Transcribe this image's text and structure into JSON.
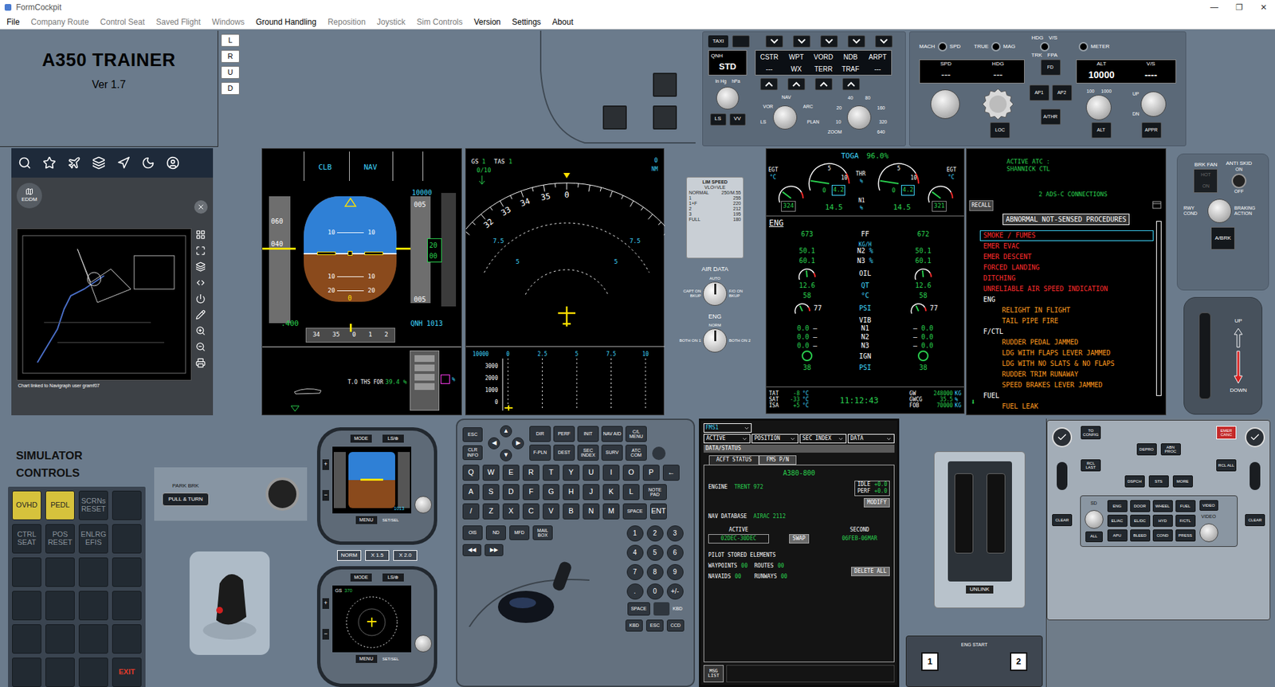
{
  "window": {
    "title": "FormCockpit",
    "controls": [
      "—",
      "❐",
      "✕"
    ]
  },
  "menu": [
    {
      "label": "File",
      "disabled": false
    },
    {
      "label": "Company Route",
      "disabled": true
    },
    {
      "label": "Control Seat",
      "disabled": true
    },
    {
      "label": "Saved Flight",
      "disabled": true
    },
    {
      "label": "Windows",
      "disabled": true
    },
    {
      "label": "Ground Handling",
      "disabled": false
    },
    {
      "label": "Reposition",
      "disabled": true
    },
    {
      "label": "Joystick",
      "disabled": true
    },
    {
      "label": "Sim Controls",
      "disabled": true
    },
    {
      "label": "Version",
      "disabled": false
    },
    {
      "label": "Settings",
      "disabled": false
    },
    {
      "label": "About",
      "disabled": false
    }
  ],
  "trainer": {
    "title": "A350 TRAINER",
    "version": "Ver 1.7",
    "views": [
      "L",
      "R",
      "U",
      "D"
    ]
  },
  "efis": {
    "taxi": "TAXI",
    "qnh_label": "QNH",
    "qnh": "STD",
    "baro_units": [
      "In Hg",
      "hPa"
    ],
    "buttons_top": [
      "CSTR",
      "WPT",
      "VORD",
      "NDB",
      "ARPT"
    ],
    "buttons_bottom": [
      "---",
      "WX",
      "TERR",
      "TRAF",
      "---"
    ],
    "ls": "LS",
    "vv": "VV",
    "mode_labels": [
      "VOR",
      "NAV",
      "ARC",
      "LS",
      "PLAN"
    ],
    "range_labels": [
      "20",
      "40",
      "80",
      "160",
      "320",
      "640",
      "10"
    ],
    "zoom": "ZOOM"
  },
  "fcu": {
    "switches": [
      {
        "left": "MACH",
        "right": "SPD"
      },
      {
        "left": "TRUE",
        "right": "MAG"
      }
    ],
    "hdg_vs": {
      "top": [
        "HDG",
        "V/S"
      ],
      "bottom": [
        "TRK",
        "FPA"
      ]
    },
    "meter": "METER",
    "left_windows": [
      {
        "label": "SPD",
        "value": "---"
      },
      {
        "label": "HDG",
        "value": "---"
      }
    ],
    "right_windows": [
      {
        "label": "ALT",
        "value": "10000"
      },
      {
        "label": "V/S",
        "value": "----"
      }
    ],
    "fd": "FD",
    "ap": [
      "AP1",
      "AP2"
    ],
    "athr": "A/THR",
    "loc": "LOC",
    "alt": "ALT",
    "appr": "APPR",
    "alt_steps": [
      "100",
      "1000"
    ],
    "vs_labels": [
      "UP",
      "DN"
    ]
  },
  "map": {
    "airport": "EDDM",
    "footer": "Chart linked to Navigraph user gramf07"
  },
  "pfd": {
    "fma": [
      "CLB",
      "NAV"
    ],
    "speeds": [
      "060",
      "040"
    ],
    "pitch": [
      "10",
      "10",
      "10",
      "10",
      "20",
      "20"
    ],
    "ground_mark": "0",
    "alt_top": "10000",
    "alt_marks": [
      "005",
      "20",
      "00",
      "005"
    ],
    "mach": ".400",
    "qnh": "QNH 1013",
    "heading": [
      "34",
      "35",
      "0",
      "1",
      "2"
    ],
    "ths_label": "T.O THS FOR",
    "ths": "39.4 %",
    "ths_unit": "%"
  },
  "nd": {
    "gs_label": "GS",
    "gs": "1",
    "tas_label": "TAS",
    "tas": "1",
    "wind": "0/10",
    "compass": [
      "32",
      "33",
      "34",
      "35",
      "0"
    ],
    "ranges": [
      "7.5",
      "5",
      "7.5",
      "5"
    ],
    "range_value": "0",
    "range_unit": "NM",
    "vd_alt": "10000",
    "vd_x": [
      "0",
      "2.5",
      "5",
      "7.5",
      "10"
    ],
    "vd_y": [
      "3000",
      "2000",
      "1000",
      "0"
    ]
  },
  "limits": {
    "title": "LIM SPEED",
    "vlo": "VLO=VLE",
    "rows": [
      {
        "conf": "NORMAL",
        "speed": "250/M.55"
      },
      {
        "conf": "1",
        "speed": "255"
      },
      {
        "conf": "1+F",
        "speed": "220"
      },
      {
        "conf": "2",
        "speed": "212"
      },
      {
        "conf": "3",
        "speed": "195"
      },
      {
        "conf": "FULL",
        "speed": "180"
      }
    ]
  },
  "air_data": {
    "title": "AIR DATA",
    "center": "AUTO",
    "left": "CAPT ON BKUP",
    "right": "F/O ON BKUP"
  },
  "eng_sel": {
    "title": "ENG",
    "center": "NORM",
    "left": "BOTH ON 1",
    "right": "BOTH ON 2"
  },
  "ewd": {
    "thrust_mode": "TOGA",
    "thrust": "96.0%",
    "engines": [
      {
        "egt": "324",
        "egt_level": 0.3,
        "n1": "14.5",
        "n1_level": 0.15,
        "thr": "0",
        "thr_cmd": "4.2",
        "ff": "673",
        "n2": "50.1",
        "n3": "60.1",
        "oil_qt": "12.6",
        "oil_level": 0.55,
        "oil_temp": "58",
        "oil_psi": "77",
        "psi_level": 0.45,
        "vib": [
          "0.0",
          "0.0",
          "0.0"
        ],
        "ign_psi": "38"
      },
      {
        "egt": "321",
        "egt_level": 0.3,
        "n1": "14.5",
        "n1_level": 0.15,
        "thr": "0",
        "thr_cmd": "4.2",
        "ff": "672",
        "n2": "50.1",
        "n3": "60.1",
        "oil_qt": "12.6",
        "oil_level": 0.55,
        "oil_temp": "58",
        "oil_psi": "77",
        "psi_level": 0.45,
        "vib": [
          "0.0",
          "0.0",
          "0.0"
        ],
        "ign_psi": "38"
      }
    ],
    "labels": {
      "egt": "EGT",
      "deg": "°C",
      "thr": "THR",
      "n1": "N1",
      "pct": "%",
      "scale": [
        "5",
        "10"
      ],
      "eng": "ENG",
      "ff": "FF",
      "ff_unit": "KG/H",
      "n2": "N2",
      "n3": "N3",
      "oil": "OIL",
      "qt": "QT",
      "psi": "PSI",
      "vib": "VIB",
      "vib_rows": [
        "N1",
        "N2",
        "N3"
      ],
      "ign": "IGN",
      "dash": "—"
    },
    "bottom": {
      "temps": [
        {
          "label": "TAT",
          "value": "-8"
        },
        {
          "label": "SAT",
          "value": "-33"
        },
        {
          "label": "ISA",
          "value": "+5"
        }
      ],
      "unit": "°C",
      "time": "11:12:43",
      "weights": [
        {
          "label": "GW",
          "value": "248000",
          "unit": "KG"
        },
        {
          "label": "GWCG",
          "value": "35.5",
          "unit": "%"
        },
        {
          "label": "FOB",
          "value": "70000",
          "unit": "KG"
        }
      ]
    }
  },
  "ecam": {
    "atc_label": "ACTIVE ATC :",
    "atc": "SHANNICK CTL",
    "adsc": "2 ADS-C CONNECTIONS",
    "recall": "RECALL",
    "header": "ABNORMAL NOT-SENSED PROCEDURES",
    "more": "⬇",
    "items": [
      {
        "text": "SMOKE / FUMES",
        "kind": "emergency",
        "selected": true
      },
      {
        "text": "EMER EVAC",
        "kind": "emergency",
        "selected": false
      },
      {
        "text": "EMER DESCENT",
        "kind": "emergency",
        "selected": false
      },
      {
        "text": "FORCED LANDING",
        "kind": "emergency",
        "selected": false
      },
      {
        "text": "DITCHING",
        "kind": "emergency",
        "selected": false
      },
      {
        "text": "UNRELIABLE AIR SPEED INDICATION",
        "kind": "emergency",
        "selected": false
      },
      {
        "text": "ENG",
        "kind": "header",
        "selected": false
      },
      {
        "text": "RELIGHT IN FLIGHT",
        "kind": "procedure",
        "selected": false
      },
      {
        "text": "TAIL PIPE FIRE",
        "kind": "procedure",
        "selected": false
      },
      {
        "text": "F/CTL",
        "kind": "header",
        "selected": false
      },
      {
        "text": "RUDDER PEDAL JAMMED",
        "kind": "procedure",
        "selected": false
      },
      {
        "text": "LDG WITH FLAPS LEVER JAMMED",
        "kind": "procedure",
        "selected": false
      },
      {
        "text": "LDG WITH NO SLATS & NO FLAPS",
        "kind": "procedure",
        "selected": false
      },
      {
        "text": "RUDDER TRIM RUNAWAY",
        "kind": "procedure",
        "selected": false
      },
      {
        "text": "SPEED BRAKES LEVER JAMMED",
        "kind": "procedure",
        "selected": false
      },
      {
        "text": "FUEL",
        "kind": "header",
        "selected": false
      },
      {
        "text": "FUEL LEAK",
        "kind": "procedure",
        "selected": false
      }
    ]
  },
  "brakes": {
    "brk_fan": "BRK FAN",
    "hot": "HOT",
    "fan_on": "ON",
    "anti_skid": "ANTI SKID",
    "skid_on": "ON",
    "skid_off": "OFF",
    "rwy_cond": "RWY COND",
    "braking_action": "BRAKING ACTION",
    "abrk": "A/BRK",
    "gear_up": "UP",
    "gear_down": "DOWN"
  },
  "sim": {
    "title": "SIMULATOR CONTROLS",
    "buttons": [
      {
        "label": "OVHD",
        "kind": "toggle",
        "active": true
      },
      {
        "label": "PEDL",
        "kind": "toggle",
        "active": true
      },
      {
        "label": "SCRNs RESET",
        "kind": "toggle",
        "active": false
      },
      {
        "label": "",
        "kind": "blank",
        "active": false
      },
      {
        "label": "CTRL SEAT",
        "kind": "toggle",
        "active": false
      },
      {
        "label": "POS RESET",
        "kind": "toggle",
        "active": false
      },
      {
        "label": "ENLRG EFIS",
        "kind": "toggle",
        "active": false
      },
      {
        "label": "",
        "kind": "blank",
        "active": false
      },
      {
        "label": "",
        "kind": "blank",
        "active": false
      },
      {
        "label": "",
        "kind": "blank",
        "active": false
      },
      {
        "label": "",
        "kind": "blank",
        "active": false
      },
      {
        "label": "",
        "kind": "blank",
        "active": false
      },
      {
        "label": "",
        "kind": "blank",
        "active": false
      },
      {
        "label": "",
        "kind": "blank",
        "active": false
      },
      {
        "label": "",
        "kind": "blank",
        "active": false
      },
      {
        "label": "",
        "kind": "blank",
        "active": false
      },
      {
        "label": "",
        "kind": "blank",
        "active": false
      },
      {
        "label": "",
        "kind": "blank",
        "active": false
      },
      {
        "label": "",
        "kind": "blank",
        "active": false
      },
      {
        "label": "",
        "kind": "blank",
        "active": false
      },
      {
        "label": "",
        "kind": "blank",
        "active": false
      },
      {
        "label": "",
        "kind": "blank",
        "active": false
      },
      {
        "label": "",
        "kind": "blank",
        "active": false
      },
      {
        "label": "EXIT",
        "kind": "exit",
        "active": false
      }
    ]
  },
  "park_brake": {
    "label": "PARK BRK",
    "knob": "PULL & TURN"
  },
  "standby": {
    "mode": "MODE",
    "ls": "LS/⊕",
    "menu": "MENU",
    "set": "SET/SEL",
    "plus": "+",
    "minus": "−",
    "zoom": [
      "NORM",
      "X 1.5",
      "X 2.0"
    ],
    "pfd_qnh": "1013",
    "nd_gs_label": "GS",
    "nd_gs": "370"
  },
  "kccu": {
    "nav": [
      "ESC",
      "CLR INFO"
    ],
    "arrows": [
      "▲",
      "◀",
      "▶",
      "▼"
    ],
    "function_keys": [
      "DIR",
      "PERF",
      "INIT",
      "NAV AID",
      "C/L MENU",
      "F-PLN",
      "DEST",
      "SEC INDEX",
      "SURV",
      "ATC COM"
    ],
    "rows": [
      [
        "Q",
        "W",
        "E",
        "R",
        "T",
        "Y",
        "U",
        "I",
        "O",
        "P",
        "←"
      ],
      [
        "A",
        "S",
        "D",
        "F",
        "G",
        "H",
        "J",
        "K",
        "L",
        "NOTE PAD"
      ],
      [
        "/",
        "Z",
        "X",
        "C",
        "V",
        "B",
        "N",
        "M",
        "SPACE",
        "ENT"
      ]
    ],
    "display_keys": [
      "OIS",
      "ND",
      "MFD",
      "MAIL BOX"
    ],
    "page_keys": [
      "◀◀",
      "▶▶"
    ],
    "numpad": [
      "1",
      "2",
      "3",
      "4",
      "5",
      "6",
      "7",
      "8",
      "9",
      ".",
      "0",
      "+/-"
    ],
    "space": "SPACE",
    "kbd_label": "KBD",
    "bottom": [
      "KBD",
      "ESC",
      "CCD"
    ]
  },
  "mfd": {
    "fms": "FMS1",
    "menus": [
      "ACTIVE",
      "POSITION",
      "SEC INDEX",
      "DATA"
    ],
    "page": "DATA/STATUS",
    "tabs": [
      {
        "label": "ACFT STATUS",
        "selected": true
      },
      {
        "label": "FMS P/N",
        "selected": false
      }
    ],
    "aircraft": "A380-800",
    "engine_label": "ENGINE",
    "engine": "TRENT 972",
    "idle_label": "IDLE",
    "idle": "+0.0",
    "perf_label": "PERF",
    "perf": "+0.0",
    "modify": "MODIFY",
    "navdb_label": "NAV DATABASE",
    "navdb": "AIRAC 2112",
    "active_label": "ACTIVE",
    "second_label": "SECOND",
    "active": "02DEC-30DEC",
    "swap": "SWAP",
    "second": "06FEB-06MAR",
    "stored_label": "PILOT STORED ELEMENTS",
    "stored": [
      {
        "label": "WAYPOINTS",
        "value": "00"
      },
      {
        "label": "ROUTES",
        "value": "00"
      },
      {
        "label": "NAVAIDS",
        "value": "00"
      },
      {
        "label": "RUNWAYS",
        "value": "00"
      }
    ],
    "delete_all": "DELETE ALL",
    "msg_list": "MSG LIST"
  },
  "throttle": {
    "unlink": "UNLINK"
  },
  "eng_start": {
    "title": "ENG START",
    "engines": [
      "1",
      "2"
    ]
  },
  "ecp": {
    "to_config": "TO CONFIG",
    "emer": "EMER CANC",
    "proc_keys": [
      "DEPRO",
      "ABN PROC"
    ],
    "recall_keys": [
      "RCL LAST",
      "RCL ALL"
    ],
    "status_keys": [
      "DSPCH",
      "STS",
      "MORE"
    ],
    "sd": "SD",
    "all": "ALL",
    "video_label": "VIDEO",
    "clear": [
      "CLEAR",
      "CLEAR"
    ],
    "pages": [
      "ENG",
      "DOOR",
      "WHEEL",
      "FUEL",
      "VIDEO",
      "EL/AC",
      "EL/DC",
      "HYD",
      "F/CTL",
      "APU",
      "BLEED",
      "COND",
      "PRESS"
    ]
  }
}
